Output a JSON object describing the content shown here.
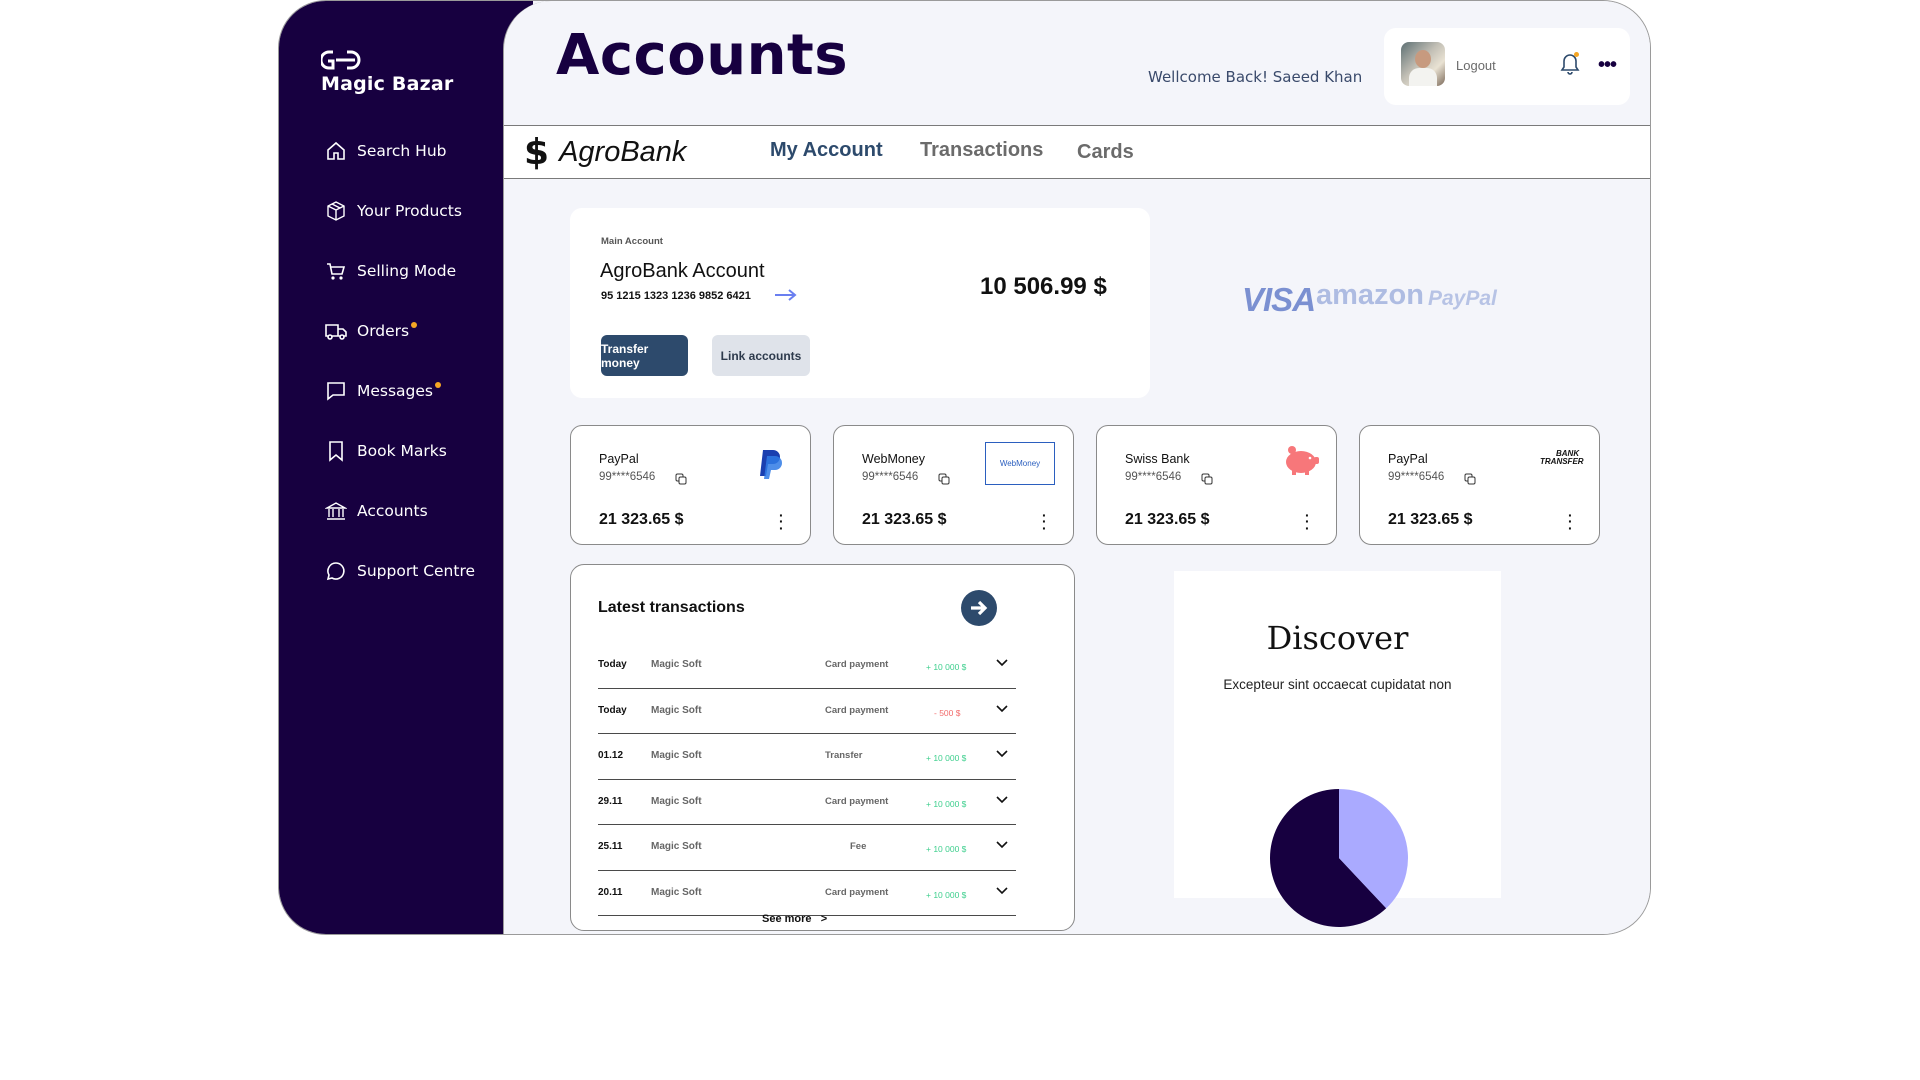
{
  "sidebar": {
    "brand": "Magic Bazar",
    "items": [
      {
        "label": "Search Hub",
        "icon": "home-icon",
        "dot": false
      },
      {
        "label": "Your Products",
        "icon": "box-icon",
        "dot": false
      },
      {
        "label": "Selling Mode",
        "icon": "cart-icon",
        "dot": false
      },
      {
        "label": "Orders",
        "icon": "truck-icon",
        "dot": true
      },
      {
        "label": "Messages",
        "icon": "message-icon",
        "dot": true
      },
      {
        "label": "Book Marks",
        "icon": "bookmark-icon",
        "dot": false
      },
      {
        "label": "Accounts",
        "icon": "bank-icon",
        "dot": false
      },
      {
        "label": "Support Centre",
        "icon": "chat-bubble-icon",
        "dot": false
      }
    ]
  },
  "header": {
    "title": "Accounts",
    "welcome": "Wellcome Back!  Saeed Khan",
    "logout": "Logout"
  },
  "tabs": {
    "bank_sign": "$",
    "bank_name": "AgroBank",
    "items": [
      "My Account",
      "Transactions",
      "Cards"
    ],
    "active": "My Account"
  },
  "main_account": {
    "label": "Main Account",
    "name": "AgroBank Account",
    "number": "95 1215 1323 1236 9852 6421",
    "balance": "10 506.99 $",
    "transfer_btn": "Transfer money",
    "link_btn": "Link accounts"
  },
  "brands": {
    "visa": "VISA",
    "amazon": "amazon",
    "paypal": "PayPal"
  },
  "accounts": [
    {
      "name": "PayPal",
      "number": "99****6546",
      "amount": "21 323.65 $",
      "logo": "paypal-logo"
    },
    {
      "name": "WebMoney",
      "number": "99****6546",
      "amount": "21 323.65 $",
      "logo": "webmoney-logo",
      "logo_text": "WebMoney"
    },
    {
      "name": "Swiss Bank",
      "number": "99****6546",
      "amount": "21 323.65 $",
      "logo": "piggy-bank-logo"
    },
    {
      "name": "PayPal",
      "number": "99****6546",
      "amount": "21 323.65 $",
      "logo": "bank-transfer-logo",
      "logo_text_1": "BANK",
      "logo_text_2": "TRANSFER"
    }
  ],
  "transactions": {
    "title": "Latest transactions",
    "rows": [
      {
        "date": "Today",
        "merchant": "Magic Soft",
        "type": "Card payment",
        "amount": "+ 10 000 $",
        "sign": "pos"
      },
      {
        "date": "Today",
        "merchant": "Magic Soft",
        "type": "Card payment",
        "amount": "- 500 $",
        "sign": "neg"
      },
      {
        "date": "01.12",
        "merchant": "Magic Soft",
        "type": "Transfer",
        "amount": "+ 10 000 $",
        "sign": "pos"
      },
      {
        "date": "29.11",
        "merchant": "Magic Soft",
        "type": "Card payment",
        "amount": "+ 10 000 $",
        "sign": "pos"
      },
      {
        "date": "25.11",
        "merchant": "Magic Soft",
        "type": "Fee",
        "amount": "+ 10 000 $",
        "sign": "pos"
      },
      {
        "date": "20.11",
        "merchant": "Magic Soft",
        "type": "Card payment",
        "amount": "+ 10 000 $",
        "sign": "pos"
      }
    ],
    "see_more": "See more   >"
  },
  "discover": {
    "title": "Discover",
    "subtitle": "Excepteur sint occaecat cupidatat non"
  },
  "pie": {
    "slices": [
      {
        "value": 0.62,
        "color": "#170040"
      },
      {
        "value": 0.38,
        "color": "#aaaaff"
      }
    ]
  },
  "colors": {
    "sidebar": "#170040",
    "accent": "#2d4a6c",
    "positive": "#3fcf8e",
    "negative": "#f26b6b",
    "notification": "#f5a623"
  }
}
